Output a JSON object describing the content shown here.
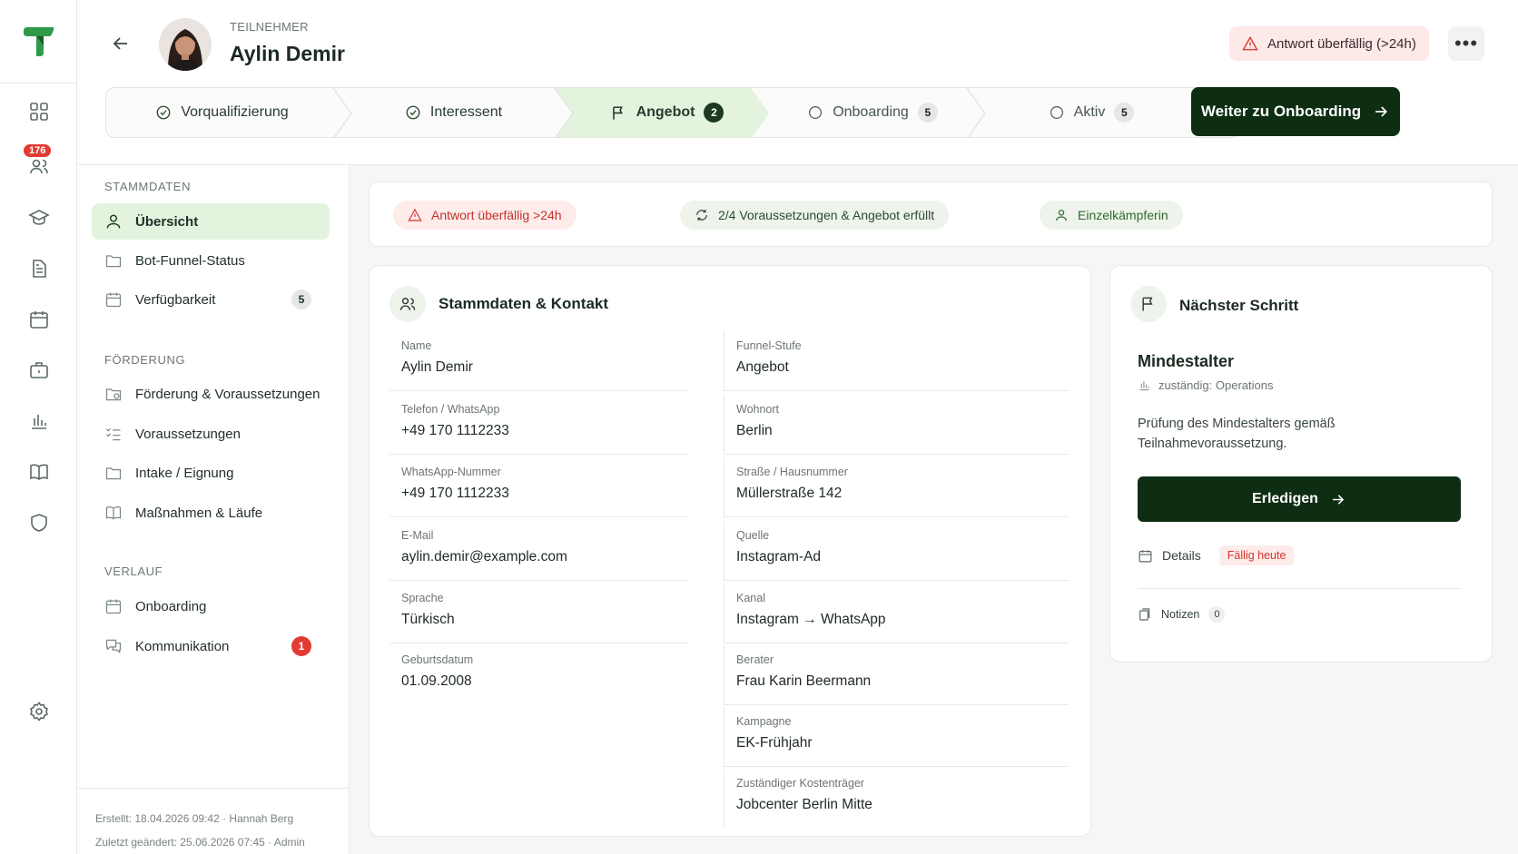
{
  "rail": {
    "badge": "176",
    "icons": [
      "grid-icon",
      "users-icon",
      "graduation-cap-icon",
      "document-icon",
      "calendar-icon",
      "briefcase-icon",
      "bar-chart-icon",
      "book-icon",
      "shield-icon",
      "settings-icon"
    ]
  },
  "header": {
    "kicker": "TEILNEHMER",
    "name": "Aylin Demir",
    "overdue": "Antwort überfällig (>24h)",
    "more": "•••",
    "cta": "Weiter zu Onboarding"
  },
  "steps": [
    {
      "label": "Vorqualifizierung",
      "state": "done"
    },
    {
      "label": "Interessent",
      "state": "done"
    },
    {
      "label": "Angebot",
      "state": "active",
      "count": "2"
    },
    {
      "label": "Onboarding",
      "state": "todo",
      "count": "5"
    },
    {
      "label": "Aktiv",
      "state": "todo",
      "count": "5"
    }
  ],
  "sidebar": {
    "sections": [
      "STAMMDATEN",
      "FÖRDERUNG",
      "VERLAUF"
    ],
    "items": [
      {
        "label": "Übersicht"
      },
      {
        "label": "Bot-Funnel-Status"
      },
      {
        "label": "Verfügbarkeit",
        "count": "5"
      },
      {
        "label": "Förderung & Voraussetzungen"
      },
      {
        "label": "Voraussetzungen"
      },
      {
        "label": "Intake / Eignung"
      },
      {
        "label": "Maßnahmen & Läufe"
      },
      {
        "label": "Onboarding"
      },
      {
        "label": "Kommunikation",
        "count": "1"
      }
    ],
    "footer": {
      "created": "Erstellt:  18.04.2026 09:42  ·  Hannah Berg",
      "modified": "Zuletzt geändert:  25.06.2026 07:45  ·  Admin"
    }
  },
  "alerts": {
    "overdue": "Antwort überfällig >24h",
    "requirements": "2/4 Voraussetzungen & Angebot erfüllt",
    "type": "Einzelkämpferin"
  },
  "contact": {
    "title": "Stammdaten & Kontakt",
    "left": [
      {
        "label": "Name",
        "value": "Aylin Demir"
      },
      {
        "label": "Telefon / WhatsApp",
        "value": "+49 170 1112233"
      },
      {
        "label": "WhatsApp-Nummer",
        "value": "+49 170 1112233"
      },
      {
        "label": "E-Mail",
        "value": "aylin.demir@example.com"
      },
      {
        "label": "Sprache",
        "value": "Türkisch"
      },
      {
        "label": "Geburtsdatum",
        "value": "01.09.2008"
      }
    ],
    "right": [
      {
        "label": "Funnel-Stufe",
        "value": "Angebot"
      },
      {
        "label": "Wohnort",
        "value": "Berlin"
      },
      {
        "label": "Straße / Hausnummer",
        "value": "Müllerstraße 142"
      },
      {
        "label": "Quelle",
        "value": "Instagram-Ad"
      },
      {
        "label": "Kanal",
        "value": "Instagram → WhatsApp"
      },
      {
        "label": "Berater",
        "value": "Frau Karin Beermann"
      },
      {
        "label": "Kampagne",
        "value": "EK-Frühjahr"
      },
      {
        "label": "Zuständiger Kostenträger",
        "value": "Jobcenter Berlin Mitte"
      }
    ]
  },
  "next": {
    "title": "Nächster Schritt",
    "task": "Mindestalter",
    "owner": "zuständig: Operations",
    "desc1": "Prüfung des Mindestalters gemäß",
    "desc2": "Teilnahmevoraussetzung.",
    "button": "Erledigen",
    "details": "Details",
    "due": "Fällig heute",
    "notes": "Notizen",
    "notes_count": "0"
  }
}
